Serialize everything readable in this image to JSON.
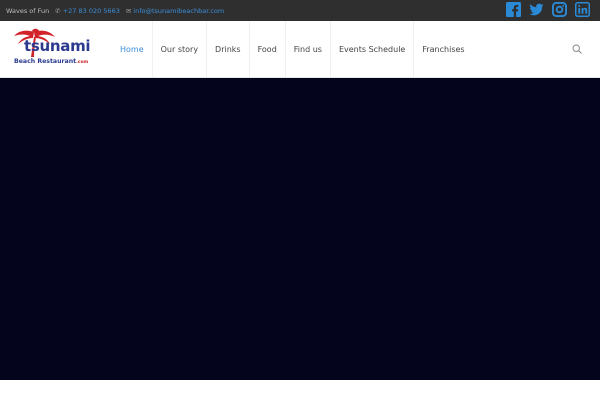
{
  "topbar": {
    "tagline": "Waves of Fun",
    "phone": "+27 83 020 5663",
    "email": "info@tsunamibeachbar.com",
    "phone_icon": "phone-icon",
    "email_icon": "envelope-icon",
    "social": [
      {
        "name": "facebook-icon",
        "color": "#2a8ad6"
      },
      {
        "name": "twitter-icon",
        "color": "#2a8ad6"
      },
      {
        "name": "instagram-icon",
        "color": "#2a8ad6"
      },
      {
        "name": "linkedin-icon",
        "color": "#2a8ad6"
      }
    ]
  },
  "logo": {
    "brand": "tsunami",
    "subtitle": "Beach Restaurant",
    "domain": ".com"
  },
  "nav": {
    "items": [
      {
        "label": "Home",
        "active": true
      },
      {
        "label": "Our story"
      },
      {
        "label": "Drinks"
      },
      {
        "label": "Food"
      },
      {
        "label": "Find us"
      },
      {
        "label": "Events Schedule"
      },
      {
        "label": "Franchises"
      }
    ],
    "search_icon": "search-icon"
  },
  "colors": {
    "topbar_bg": "#2f2f2f",
    "accent": "#3b8ed8",
    "hero_bg": "#04051c",
    "brand_blue": "#2b3a8f",
    "brand_red": "#d2232a"
  }
}
